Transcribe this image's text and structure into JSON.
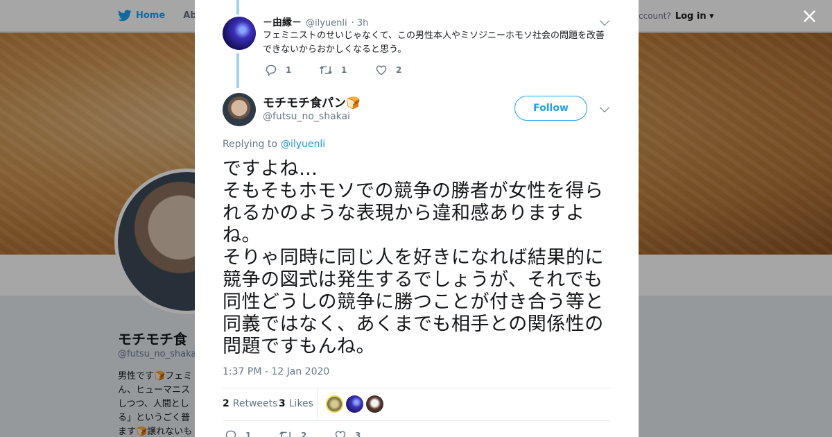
{
  "background": {
    "nav": {
      "home": "Home",
      "about": "Abo"
    },
    "account_prompt": "ccount?",
    "login": "Log in",
    "profile_name": "モチモチ食",
    "profile_handle": "@futsu_no_shaka",
    "bio_lines": [
      "男性です🍞フェミ",
      "ん、ヒューマニス",
      "しつつ、人間とし",
      "る」というごく普",
      "ます🍞譲れないも"
    ]
  },
  "parent_tweet": {
    "name": "－由縁－",
    "handle": "@ilyuenli",
    "time": "· 3h",
    "text": "フェミニストのせいじゃなくて、この男性本人やミソジニーホモソ社会の問題を改善できないからおかしくなると思う。",
    "replies": "1",
    "retweets": "1",
    "likes": "2"
  },
  "main_tweet": {
    "name": "モチモチ食パン🍞",
    "handle": "@futsu_no_shakai",
    "follow_label": "Follow",
    "replying_prefix": "Replying to",
    "replying_handle": "@ilyuenli",
    "text": "ですよね…\nそもそもホモソでの競争の勝者が女性を得られるかのような表現から違和感ありますよね。\nそりゃ同時に同じ人を好きになれば結果的に競争の図式は発生するでしょうが、それでも同性どうしの競争に勝つことが付き合う等と同義ではなく、あくまでも相手との関係性の問題ですもんね。",
    "timestamp": "1:37 PM - 12 Jan 2020",
    "retweet_count": "2",
    "retweet_label": "Retweets",
    "like_count": "3",
    "like_label": "Likes",
    "replies": "1",
    "retweets": "2",
    "likes": "3"
  },
  "colors": {
    "accent": "#1da1f2",
    "link": "#1b95e0",
    "thread_line": "#9ad3f5",
    "muted": "#657786"
  },
  "icons": [
    "twitter-bird-icon",
    "reply-icon",
    "retweet-icon",
    "like-icon",
    "close-icon",
    "chevron-down-icon"
  ]
}
